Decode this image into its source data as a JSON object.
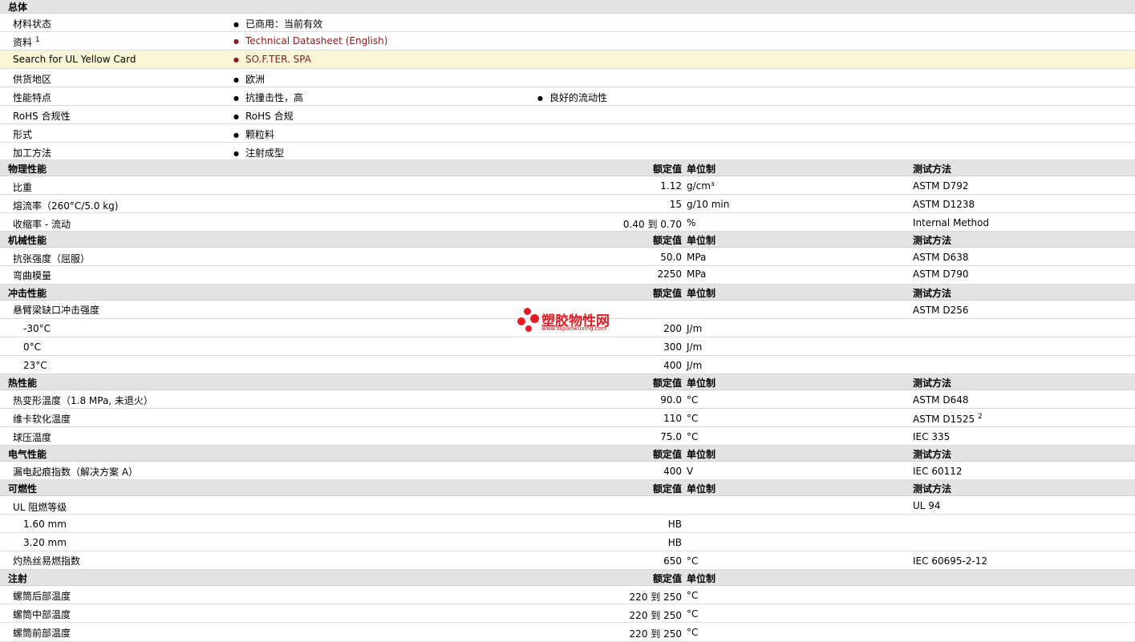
{
  "general": {
    "title": "总体",
    "rows": [
      {
        "label": "材料状态",
        "value": "已商用：当前有效"
      },
      {
        "label": "资料",
        "sup": "1",
        "value": "Technical Datasheet (English)"
      },
      {
        "label": "Search for UL Yellow Card",
        "value": "SO.F.TER. SPA"
      },
      {
        "label": "供货地区",
        "value": "欧洲"
      },
      {
        "label": "性能特点",
        "value": "抗撞击性，高",
        "value2": "良好的流动性"
      },
      {
        "label": "RoHS 合规性",
        "value": "RoHS 合规"
      },
      {
        "label": "形式",
        "value": "颗粒料"
      },
      {
        "label": "加工方法",
        "value": "注射成型"
      }
    ]
  },
  "columns": {
    "nominal": "额定值",
    "unit": "单位制",
    "test": "测试方法"
  },
  "physical": {
    "title": "物理性能",
    "rows": [
      {
        "label": "比重",
        "value": "1.12",
        "unit": "g/cm³",
        "test": "ASTM D792"
      },
      {
        "label": "熔流率（260°C/5.0 kg)",
        "value": "15",
        "unit": "g/10 min",
        "test": "ASTM D1238"
      },
      {
        "label": "收缩率 - 流动",
        "value": "0.40 到  0.70",
        "unit": "%",
        "test": "Internal Method"
      }
    ]
  },
  "mechanical": {
    "title": "机械性能",
    "rows": [
      {
        "label": "抗张强度（屈服）",
        "value": "50.0",
        "unit": "MPa",
        "test": "ASTM D638"
      },
      {
        "label": "弯曲模量",
        "value": "2250",
        "unit": "MPa",
        "test": "ASTM D790"
      }
    ]
  },
  "impact": {
    "title": "冲击性能",
    "rows": [
      {
        "label": "悬臂梁缺口冲击强度",
        "value": "",
        "unit": "",
        "test": "ASTM D256"
      },
      {
        "label": "-30°C",
        "value": "200",
        "unit": "J/m",
        "test": ""
      },
      {
        "label": "0°C",
        "value": "300",
        "unit": "J/m",
        "test": ""
      },
      {
        "label": "23°C",
        "value": "400",
        "unit": "J/m",
        "test": ""
      }
    ]
  },
  "thermal": {
    "title": "热性能",
    "rows": [
      {
        "label": "热变形温度（1.8 MPa, 未退火）",
        "value": "90.0",
        "unit": "°C",
        "test": "ASTM D648"
      },
      {
        "label": "维卡软化温度",
        "value": "110",
        "unit": "°C",
        "test": "ASTM D1525",
        "sup": "2"
      },
      {
        "label": "球压温度",
        "value": "75.0",
        "unit": "°C",
        "test": "IEC 335"
      }
    ]
  },
  "electrical": {
    "title": "电气性能",
    "rows": [
      {
        "label": "漏电起痕指数（解决方案 A）",
        "value": "400",
        "unit": "V",
        "test": "IEC 60112"
      }
    ]
  },
  "flammability": {
    "title": "可燃性",
    "rows": [
      {
        "label": "UL 阻燃等级",
        "value": "",
        "unit": "",
        "test": "UL 94"
      },
      {
        "label": "1.60 mm",
        "value": "HB",
        "unit": "",
        "test": ""
      },
      {
        "label": "3.20 mm",
        "value": "HB",
        "unit": "",
        "test": ""
      },
      {
        "label": "灼热丝易燃指数",
        "value": "650",
        "unit": "°C",
        "test": "IEC 60695-2-12"
      }
    ]
  },
  "injection": {
    "title": "注射",
    "rows": [
      {
        "label": "螺筒后部温度",
        "value": "220 到  250",
        "unit": "°C"
      },
      {
        "label": "螺筒中部温度",
        "value": "220 到  250",
        "unit": "°C"
      },
      {
        "label": "螺筒前部温度",
        "value": "220 到  250",
        "unit": "°C"
      }
    ]
  },
  "watermark": {
    "name": "塑胶物性网",
    "url": "www.sujiaowuxing.com"
  }
}
